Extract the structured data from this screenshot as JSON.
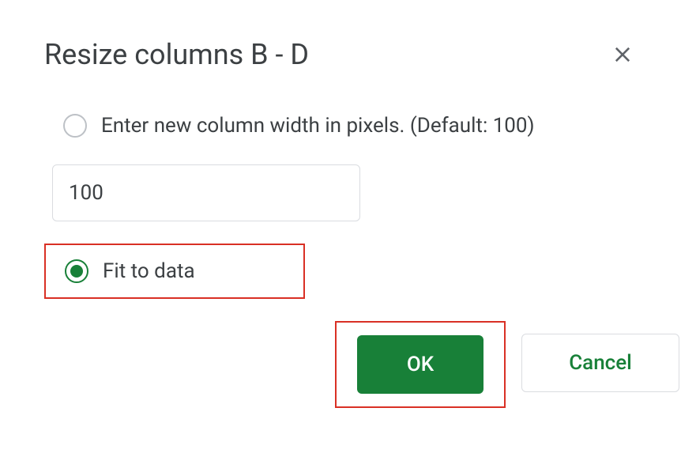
{
  "dialog": {
    "title": "Resize columns B - D",
    "options": {
      "enter_width_label": "Enter new column width in pixels. (Default: 100)",
      "fit_to_data_label": "Fit to data",
      "selected": "fit_to_data"
    },
    "input": {
      "value": "100"
    },
    "buttons": {
      "ok_label": "OK",
      "cancel_label": "Cancel"
    }
  }
}
